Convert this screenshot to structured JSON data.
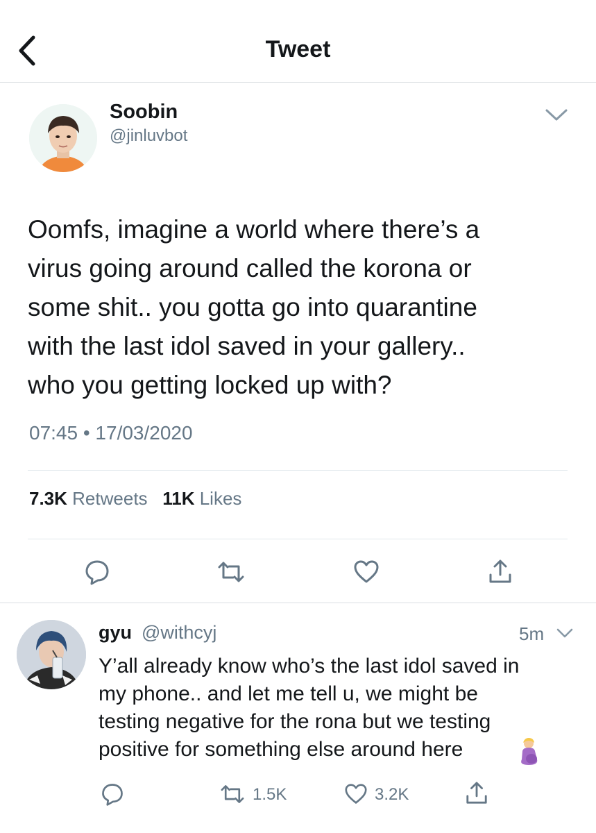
{
  "header": {
    "title": "Tweet"
  },
  "tweet": {
    "author_name": "Soobin",
    "author_handle": "@jinluvbot",
    "text": "Oomfs, imagine a world where there’s a\nvirus going around called the korona or\nsome shit.. you gotta go into quarantine\nwith the last idol saved in your gallery..\nwho you getting locked up with?",
    "time": "07:45 • 17/03/2020",
    "retweets_count": "7.3K",
    "retweets_label": "Retweets",
    "likes_count": "11K",
    "likes_label": "Likes"
  },
  "reply": {
    "name": "gyu",
    "handle": "@withcyj",
    "time": "5m",
    "text": "Y’all already know who’s the last idol saved in\nmy phone.. and let me tell u, we might be\ntesting negative for the rona but we testing\npositive for something else around here",
    "retweets_count": "1.5K",
    "likes_count": "3.2K"
  },
  "colors": {
    "text": "#14171a",
    "secondary": "#657786",
    "divider": "#e1e8ed",
    "icon": "#657786"
  }
}
